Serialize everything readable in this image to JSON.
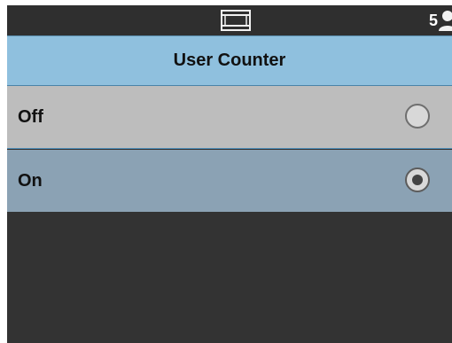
{
  "status_bar": {
    "scanner_icon": "scanner-icon",
    "user_count": "5",
    "user_icon": "user-icon"
  },
  "header": {
    "title": "User Counter"
  },
  "options": [
    {
      "label": "Off",
      "selected": false,
      "radio_icon": "radio-unselected-icon"
    },
    {
      "label": "On",
      "selected": true,
      "radio_icon": "radio-selected-icon"
    }
  ],
  "colors": {
    "status_bar_bg": "#2f2f2f",
    "title_bg": "#8fc0de",
    "off_row_bg": "#bdbdbd",
    "on_row_bg": "#8ba2b4",
    "screen_bg": "#333333",
    "text": "#111111"
  }
}
